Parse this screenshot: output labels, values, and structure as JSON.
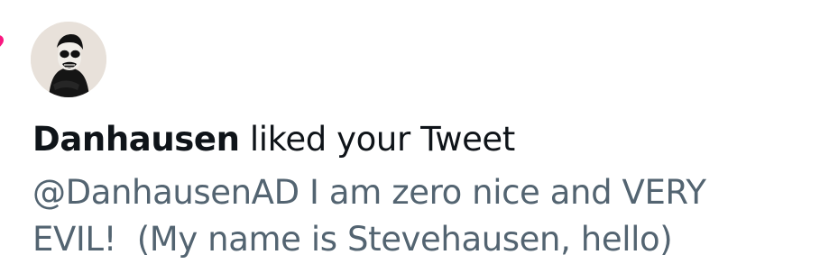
{
  "notification": {
    "icon": "heart-icon",
    "icon_color": "#f91880",
    "avatar_alt": "Danhausen avatar",
    "user_name": "Danhausen",
    "action_text": " liked your Tweet",
    "tweet_lines": [
      "@DanhausenAD I am zero nice and VERY",
      "EVIL!  (My name is Stevehausen, hello)"
    ]
  },
  "colors": {
    "primary_text": "#0f1419",
    "secondary_text": "#536471",
    "background": "#ffffff"
  }
}
